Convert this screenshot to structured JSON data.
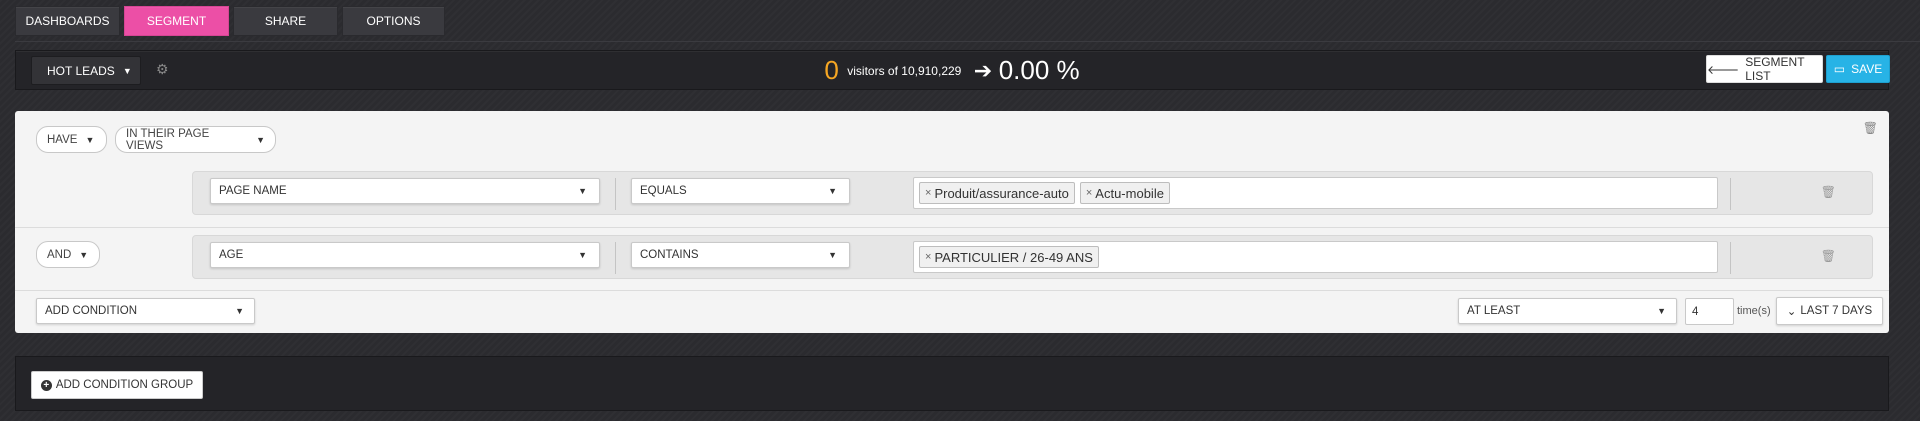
{
  "tabs": [
    "DASHBOARDS",
    "SEGMENT",
    "SHARE",
    "OPTIONS"
  ],
  "active_tab": "SEGMENT",
  "header": {
    "segment_name": "HOT LEADS",
    "visitor_count": "0",
    "visitors_text": "visitors of 10,910,229",
    "percentage": "0.00 %",
    "segment_list_label": "SEGMENT LIST",
    "save_label": "SAVE"
  },
  "group": {
    "have_label": "HAVE",
    "scope_label": "IN THEIR PAGE VIEWS",
    "conditions": [
      {
        "field": "PAGE NAME",
        "operator": "EQUALS",
        "values": [
          "Produit/assurance-auto",
          "Actu-mobile"
        ]
      },
      {
        "connector": "AND",
        "field": "AGE",
        "operator": "CONTAINS",
        "values": [
          "PARTICULIER / 26-49 ANS"
        ]
      }
    ],
    "add_condition_label": "ADD CONDITION",
    "frequency_label": "AT LEAST",
    "times_value": "4",
    "times_suffix": "time(s)",
    "period_label": "LAST 7 DAYS"
  },
  "add_group_label": "ADD CONDITION GROUP",
  "colors": {
    "accent_pink": "#ec4fa6",
    "count_orange": "#f5a623",
    "save_blue": "#27b3e6"
  },
  "icons": {
    "gear": "gear-icon",
    "arrow": "arrow-right-icon",
    "back": "arrow-left-icon",
    "save": "save-icon",
    "trash": "trash-icon",
    "remove": "remove-tag-icon",
    "chevron": "chevron-down-icon",
    "plus": "plus-circle-icon"
  }
}
